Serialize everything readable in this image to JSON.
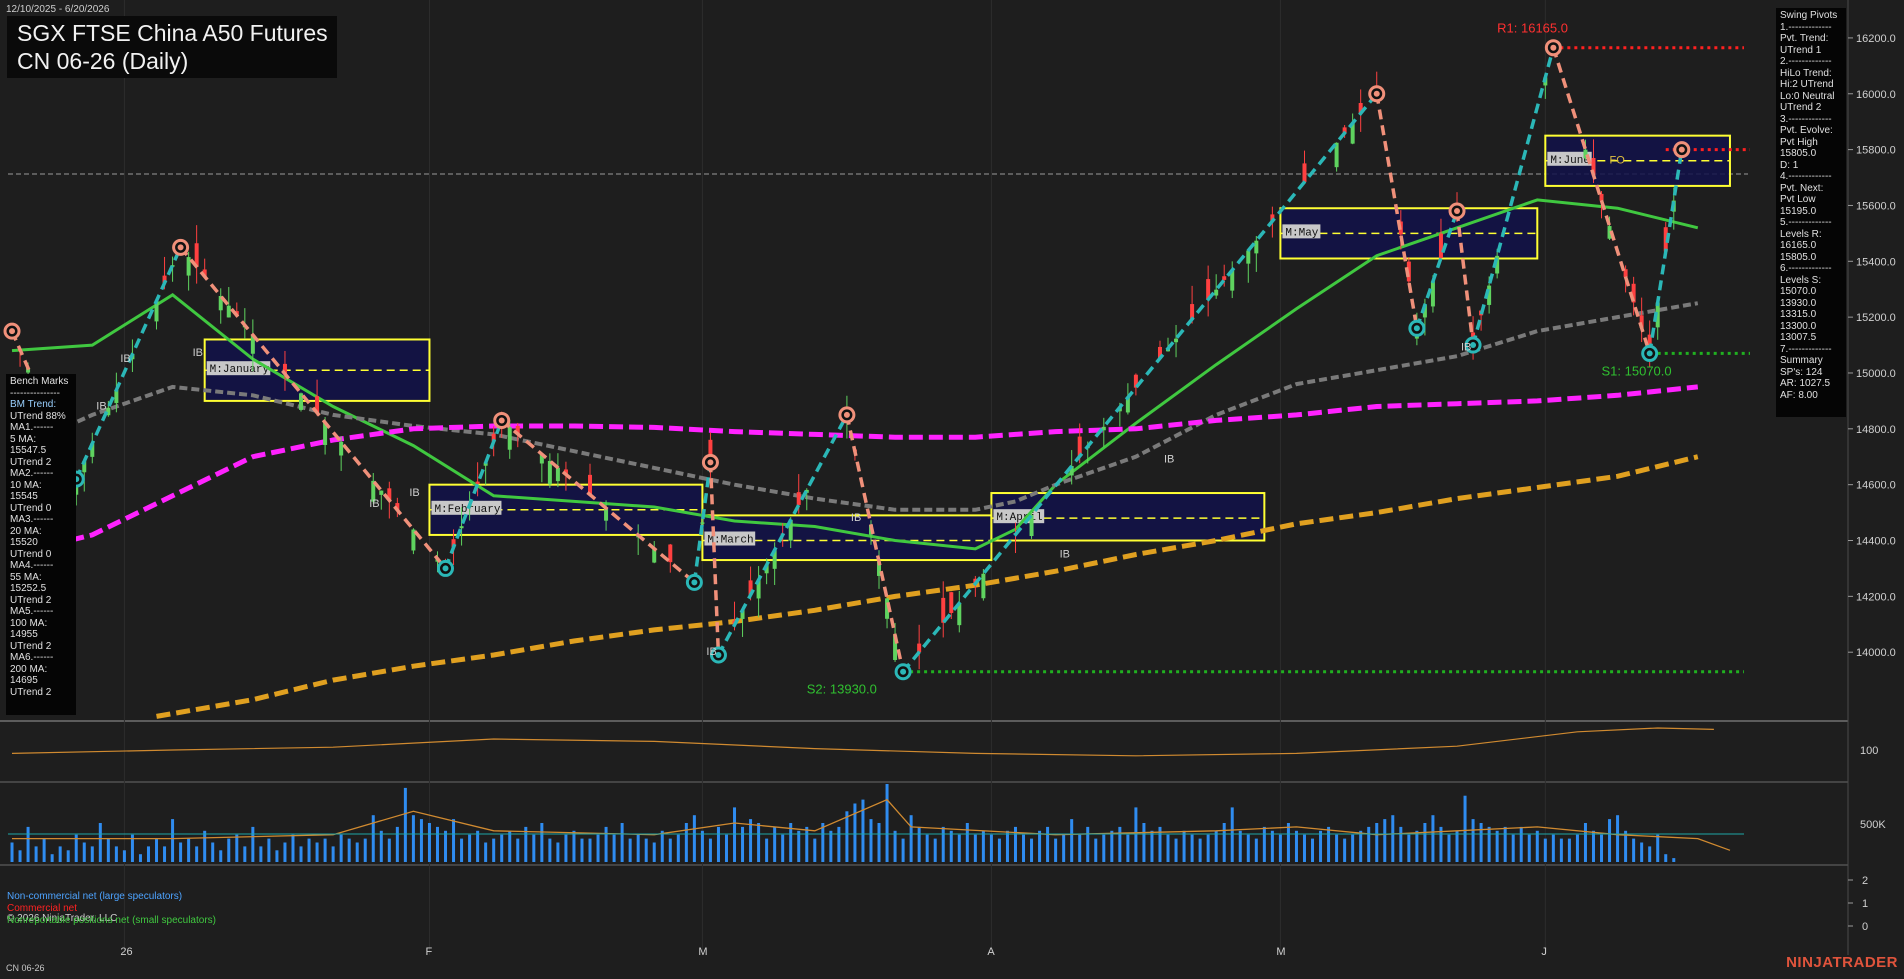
{
  "header": {
    "date_range": "12/10/2025 - 6/20/2026",
    "title": "SGX FTSE China A50 Futures",
    "subtitle": "CN 06-26 (Daily)"
  },
  "chart_data": {
    "type": "line",
    "ylim": [
      13750,
      16300
    ],
    "price_ticks": [
      16200,
      16000,
      15800,
      15600,
      15400,
      15200,
      15000,
      14800,
      14600,
      14400,
      14200,
      14000
    ],
    "price_tick_labels": [
      "16200.0",
      "16000.0",
      "15800.0",
      "15600.0",
      "15400.0",
      "15200.0",
      "15000.0",
      "14800.0",
      "14600.0",
      "14400.0",
      "14200.0",
      "14000.0"
    ],
    "x_labels": [
      {
        "label": "26",
        "day": 14
      },
      {
        "label": "F",
        "day": 52
      },
      {
        "label": "M",
        "day": 86
      },
      {
        "label": "A",
        "day": 122
      },
      {
        "label": "M",
        "day": 158
      },
      {
        "label": "J",
        "day": 191
      }
    ],
    "n_days": 216,
    "swing_points": [
      {
        "day": 0,
        "price": 15150,
        "type": "high"
      },
      {
        "day": 8,
        "price": 14620,
        "type": "low"
      },
      {
        "day": 21,
        "price": 15450,
        "type": "high"
      },
      {
        "day": 54,
        "price": 14300,
        "type": "low"
      },
      {
        "day": 61,
        "price": 14830,
        "type": "high"
      },
      {
        "day": 85,
        "price": 14250,
        "type": "low"
      },
      {
        "day": 87,
        "price": 14680,
        "type": "high"
      },
      {
        "day": 88,
        "price": 13990,
        "type": "low"
      },
      {
        "day": 104,
        "price": 14850,
        "type": "high"
      },
      {
        "day": 111,
        "price": 13930,
        "type": "low"
      },
      {
        "day": 170,
        "price": 16000,
        "type": "high"
      },
      {
        "day": 175,
        "price": 15160,
        "type": "low"
      },
      {
        "day": 180,
        "price": 15580,
        "type": "high"
      },
      {
        "day": 182,
        "price": 15100,
        "type": "low"
      },
      {
        "day": 192,
        "price": 16165,
        "type": "high"
      },
      {
        "day": 204,
        "price": 15070,
        "type": "low"
      },
      {
        "day": 208,
        "price": 15800,
        "type": "high"
      }
    ],
    "series": [
      {
        "name": "MA 20",
        "color": "#40c840",
        "points": [
          [
            0,
            15080
          ],
          [
            10,
            15100
          ],
          [
            20,
            15280
          ],
          [
            30,
            15050
          ],
          [
            40,
            14880
          ],
          [
            50,
            14740
          ],
          [
            60,
            14560
          ],
          [
            70,
            14540
          ],
          [
            80,
            14520
          ],
          [
            90,
            14470
          ],
          [
            100,
            14450
          ],
          [
            110,
            14400
          ],
          [
            120,
            14370
          ],
          [
            125,
            14440
          ],
          [
            130,
            14600
          ],
          [
            140,
            14820
          ],
          [
            150,
            15030
          ],
          [
            160,
            15230
          ],
          [
            170,
            15420
          ],
          [
            180,
            15520
          ],
          [
            190,
            15620
          ],
          [
            200,
            15590
          ],
          [
            210,
            15520
          ]
        ]
      },
      {
        "name": "MA 55",
        "color": "#7a7a7a",
        "dash": true,
        "points": [
          [
            0,
            14720
          ],
          [
            10,
            14850
          ],
          [
            20,
            14950
          ],
          [
            30,
            14920
          ],
          [
            40,
            14850
          ],
          [
            50,
            14810
          ],
          [
            60,
            14780
          ],
          [
            70,
            14720
          ],
          [
            80,
            14660
          ],
          [
            90,
            14600
          ],
          [
            100,
            14550
          ],
          [
            110,
            14510
          ],
          [
            120,
            14510
          ],
          [
            125,
            14540
          ],
          [
            130,
            14600
          ],
          [
            140,
            14700
          ],
          [
            150,
            14850
          ],
          [
            160,
            14960
          ],
          [
            170,
            15010
          ],
          [
            180,
            15060
          ],
          [
            190,
            15150
          ],
          [
            200,
            15200
          ],
          [
            210,
            15250
          ]
        ]
      },
      {
        "name": "MA 100",
        "color": "#ff22ff",
        "dash": true,
        "points": [
          [
            0,
            14350
          ],
          [
            10,
            14420
          ],
          [
            20,
            14560
          ],
          [
            30,
            14700
          ],
          [
            40,
            14760
          ],
          [
            50,
            14800
          ],
          [
            60,
            14810
          ],
          [
            70,
            14810
          ],
          [
            80,
            14805
          ],
          [
            90,
            14790
          ],
          [
            100,
            14780
          ],
          [
            110,
            14770
          ],
          [
            120,
            14770
          ],
          [
            130,
            14790
          ],
          [
            140,
            14800
          ],
          [
            150,
            14830
          ],
          [
            160,
            14850
          ],
          [
            170,
            14880
          ],
          [
            180,
            14890
          ],
          [
            190,
            14900
          ],
          [
            200,
            14920
          ],
          [
            210,
            14950
          ]
        ]
      },
      {
        "name": "MA 200",
        "color": "#e0a020",
        "dash": true,
        "points": [
          [
            18,
            13770
          ],
          [
            30,
            13830
          ],
          [
            40,
            13900
          ],
          [
            50,
            13950
          ],
          [
            60,
            13990
          ],
          [
            70,
            14040
          ],
          [
            80,
            14080
          ],
          [
            90,
            14110
          ],
          [
            100,
            14150
          ],
          [
            110,
            14200
          ],
          [
            120,
            14240
          ],
          [
            130,
            14290
          ],
          [
            140,
            14350
          ],
          [
            150,
            14400
          ],
          [
            160,
            14460
          ],
          [
            170,
            14500
          ],
          [
            180,
            14550
          ],
          [
            190,
            14590
          ],
          [
            200,
            14630
          ],
          [
            210,
            14700
          ]
        ]
      }
    ],
    "monthly_boxes": [
      {
        "label": "M:January",
        "start_day": 24,
        "end_day": 52,
        "high": 15120,
        "low": 14900,
        "mid": 15010
      },
      {
        "label": "M:February",
        "start_day": 52,
        "end_day": 86,
        "high": 14600,
        "low": 14420,
        "mid": 14510
      },
      {
        "label": "M:March",
        "start_day": 86,
        "end_day": 122,
        "high": 14490,
        "low": 14330,
        "mid": 14400
      },
      {
        "label": "M:April",
        "start_day": 122,
        "end_day": 156,
        "high": 14570,
        "low": 14400,
        "mid": 14480
      },
      {
        "label": "M:May",
        "start_day": 158,
        "end_day": 190,
        "high": 15590,
        "low": 15410,
        "mid": 15500
      },
      {
        "label": "M:June",
        "start_day": 191,
        "end_day": 214,
        "high": 15850,
        "low": 15670,
        "mid": 15760
      }
    ],
    "resistance_label": "R1: 16165.0",
    "resistance_value": 16165,
    "support1_label": "S1: 15070.0",
    "support1_value": 15070,
    "support2_label": "S2: 13930.0",
    "support2_value": 13930,
    "fo_label": "FO",
    "ib_label": "IB",
    "oscillator": {
      "tick_label": "100",
      "points": [
        [
          0,
          0.55
        ],
        [
          20,
          0.48
        ],
        [
          40,
          0.42
        ],
        [
          60,
          0.25
        ],
        [
          80,
          0.3
        ],
        [
          100,
          0.45
        ],
        [
          120,
          0.55
        ],
        [
          140,
          0.6
        ],
        [
          160,
          0.55
        ],
        [
          180,
          0.4
        ],
        [
          195,
          0.1
        ],
        [
          205,
          0.02
        ],
        [
          212,
          0.05
        ]
      ]
    },
    "volume": {
      "tick_label": "500K",
      "bars": [
        0.25,
        0.15,
        0.45,
        0.2,
        0.3,
        0.1,
        0.2,
        0.15,
        0.35,
        0.25,
        0.2,
        0.5,
        0.3,
        0.2,
        0.15,
        0.35,
        0.1,
        0.2,
        0.3,
        0.2,
        0.55,
        0.25,
        0.3,
        0.2,
        0.4,
        0.25,
        0.15,
        0.3,
        0.35,
        0.2,
        0.45,
        0.2,
        0.3,
        0.15,
        0.25,
        0.35,
        0.2,
        0.3,
        0.25,
        0.3,
        0.2,
        0.35,
        0.3,
        0.25,
        0.3,
        0.6,
        0.4,
        0.3,
        0.45,
        0.95,
        0.6,
        0.55,
        0.5,
        0.45,
        0.4,
        0.55,
        0.3,
        0.35,
        0.4,
        0.25,
        0.3,
        0.35,
        0.4,
        0.3,
        0.45,
        0.35,
        0.5,
        0.3,
        0.25,
        0.35,
        0.4,
        0.3,
        0.3,
        0.35,
        0.45,
        0.35,
        0.5,
        0.3,
        0.35,
        0.3,
        0.25,
        0.4,
        0.3,
        0.35,
        0.5,
        0.6,
        0.4,
        0.3,
        0.45,
        0.35,
        0.7,
        0.45,
        0.55,
        0.5,
        0.3,
        0.45,
        0.35,
        0.5,
        0.4,
        0.45,
        0.3,
        0.5,
        0.4,
        0.45,
        0.65,
        0.75,
        0.8,
        0.55,
        0.5,
        1.0,
        0.4,
        0.3,
        0.6,
        0.45,
        0.35,
        0.3,
        0.45,
        0.4,
        0.35,
        0.5,
        0.35,
        0.4,
        0.35,
        0.3,
        0.4,
        0.45,
        0.35,
        0.3,
        0.4,
        0.45,
        0.3,
        0.35,
        0.55,
        0.35,
        0.45,
        0.3,
        0.35,
        0.4,
        0.45,
        0.35,
        0.7,
        0.5,
        0.4,
        0.45,
        0.35,
        0.3,
        0.4,
        0.35,
        0.3,
        0.35,
        0.4,
        0.5,
        0.7,
        0.4,
        0.35,
        0.3,
        0.45,
        0.4,
        0.35,
        0.5,
        0.4,
        0.35,
        0.3,
        0.4,
        0.45,
        0.35,
        0.3,
        0.35,
        0.4,
        0.45,
        0.5,
        0.55,
        0.6,
        0.45,
        0.35,
        0.4,
        0.5,
        0.6,
        0.45,
        0.35,
        0.4,
        0.85,
        0.55,
        0.5,
        0.45,
        0.4,
        0.45,
        0.35,
        0.45,
        0.35,
        0.4,
        0.3,
        0.35,
        0.3,
        0.3,
        0.35,
        0.5,
        0.4,
        0.35,
        0.55,
        0.6,
        0.4,
        0.3,
        0.25,
        0.2,
        0.35,
        0.1,
        0.05
      ],
      "avg_points": [
        [
          0,
          0.3
        ],
        [
          20,
          0.3
        ],
        [
          40,
          0.35
        ],
        [
          50,
          0.65
        ],
        [
          60,
          0.4
        ],
        [
          80,
          0.35
        ],
        [
          90,
          0.5
        ],
        [
          100,
          0.4
        ],
        [
          109,
          0.8
        ],
        [
          112,
          0.45
        ],
        [
          130,
          0.35
        ],
        [
          150,
          0.4
        ],
        [
          160,
          0.45
        ],
        [
          170,
          0.35
        ],
        [
          180,
          0.4
        ],
        [
          190,
          0.45
        ],
        [
          200,
          0.35
        ],
        [
          210,
          0.3
        ],
        [
          214,
          0.15
        ]
      ]
    },
    "cot": {
      "tick_labels": [
        "2",
        "1",
        "0"
      ],
      "legend": [
        {
          "label": "Non-commercial net (large speculators)",
          "color": "#4da3ff"
        },
        {
          "label": "Commercial net",
          "color": "#ff2222"
        },
        {
          "label": "Nonreportable positions net (small speculators)",
          "color": "#40c840"
        }
      ]
    }
  },
  "bench_marks": {
    "lines": [
      "Bench Marks",
      "---------------",
      "BM Trend:",
      "UTrend 88%",
      "MA1.------",
      "5 MA:",
      "15547.5",
      "UTrend 2",
      "MA2.------",
      "10 MA:",
      "15545",
      "UTrend 0",
      "MA3.------",
      "20 MA:",
      "15520",
      "UTrend 0",
      "MA4.------",
      "55 MA:",
      "15252.5",
      "UTrend 2",
      "MA5.------",
      "100 MA:",
      "14955",
      "UTrend 2",
      "MA6.------",
      "200 MA:",
      "14695",
      "UTrend 2"
    ]
  },
  "swing_pivots": {
    "lines": [
      "Swing Pivots",
      "1.-------------",
      "Pvt. Trend:",
      "UTrend 1",
      "2.-------------",
      "HiLo Trend:",
      "Hi:2 UTrend",
      "Lo:0 Neutral",
      "UTrend 2",
      "3.-------------",
      "Pvt. Evolve:",
      "Pvt High",
      "15805.0",
      "D: 1",
      "4.-------------",
      "Pvt. Next:",
      "Pvt Low",
      "15195.0",
      "5.-------------",
      "Levels R:",
      "16165.0",
      "15805.0",
      "6.-------------",
      "Levels S:",
      "15070.0",
      "13930.0",
      "13315.0",
      "13300.0",
      "13007.5",
      "7.-------------",
      "Summary",
      "SP's: 124",
      "AR: 1027.5",
      "AF: 8.00"
    ]
  },
  "footer": {
    "copyright": "© 2026 NinjaTrader, LLC",
    "ticker": "CN 06-26",
    "brand": "NINJATRADER"
  },
  "colors": {
    "background": "#1e1e1e",
    "up_candle": "#5fd35f",
    "down_candle": "#ff4040",
    "pivot_up_line": "#2bb7b7",
    "pivot_down_line": "#f0907a",
    "box_fill": "#12124a",
    "box_border": "#ffff33",
    "resistance": "#ff2020",
    "support": "#20b020"
  }
}
